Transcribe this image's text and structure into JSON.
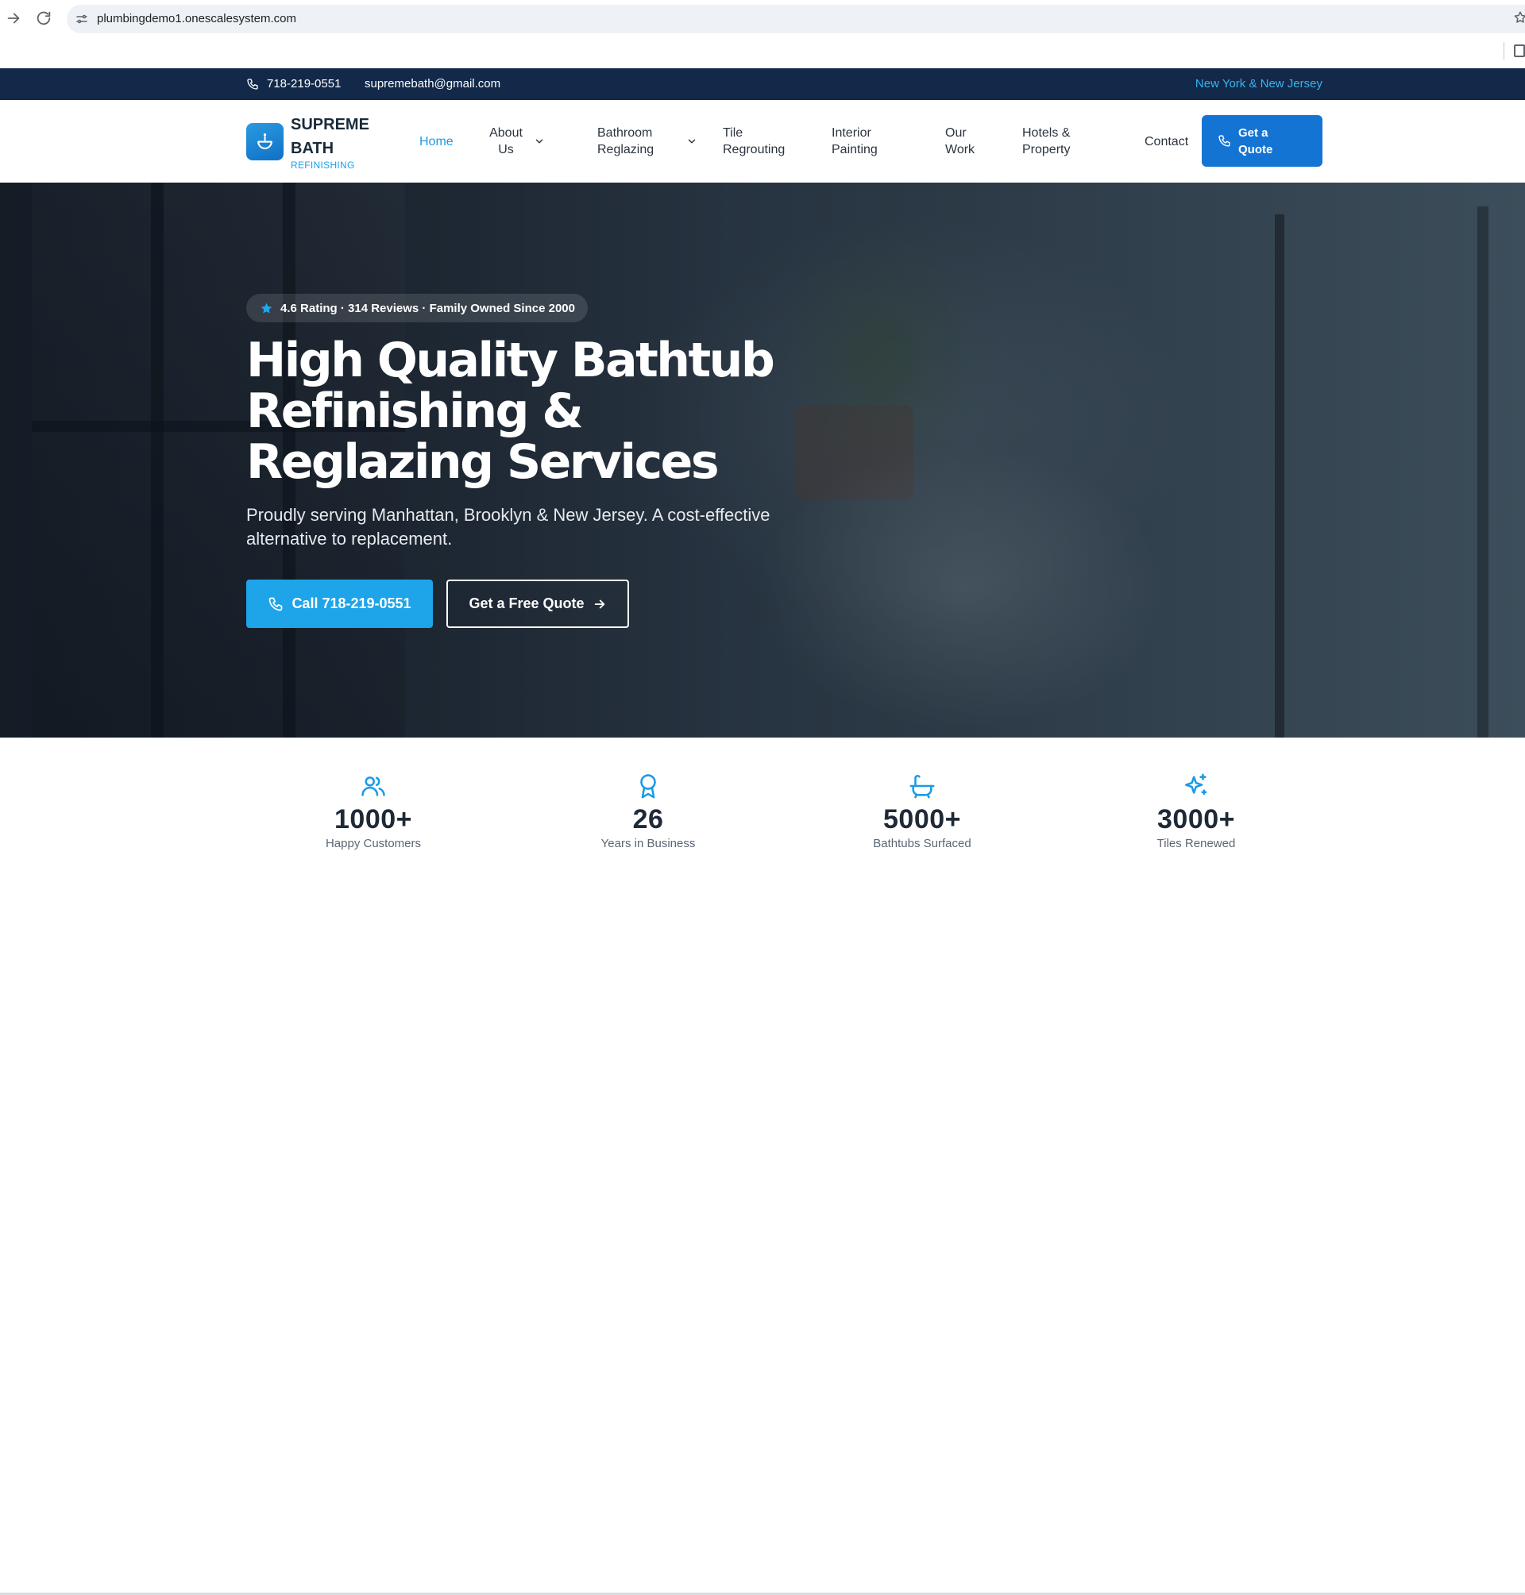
{
  "browser": {
    "url": "plumbingdemo1.onescalesystem.com",
    "icons": [
      "forward-icon",
      "reload-icon",
      "site-info-icon",
      "bookmark-star-icon",
      "side-panel-icon"
    ]
  },
  "topbar": {
    "phone": "718-219-0551",
    "email": "supremebath@gmail.com",
    "region": "New York & New Jersey"
  },
  "brand": {
    "line1": "SUPREME",
    "line2": "BATH",
    "tagline": "REFINISHING"
  },
  "nav": {
    "home": "Home",
    "about_l1": "About",
    "about_l2": "Us",
    "bathroom_l1": "Bathroom",
    "bathroom_l2": "Reglazing",
    "tile_l1": "Tile",
    "tile_l2": "Regrouting",
    "interior_l1": "Interior",
    "interior_l2": "Painting",
    "work_l1": "Our",
    "work_l2": "Work",
    "hotels_l1": "Hotels &",
    "hotels_l2": "Property",
    "contact": "Contact",
    "quote_l1": "Get a",
    "quote_l2": "Quote"
  },
  "hero": {
    "rating": "4.6 Rating · 314 Reviews · Family Owned Since 2000",
    "title_l1": "High Quality Bathtub",
    "title_l2": "Refinishing &",
    "title_l3": "Reglazing Services",
    "subtitle": "Proudly serving Manhattan, Brooklyn & New Jersey. A cost-effective alternative to replacement.",
    "call_button": "Call 718-219-0551",
    "quote_button": "Get a Free Quote"
  },
  "stats": [
    {
      "icon": "users-icon",
      "value": "1000+",
      "label": "Happy Customers"
    },
    {
      "icon": "award-icon",
      "value": "26",
      "label": "Years in Business"
    },
    {
      "icon": "bathtub-icon",
      "value": "5000+",
      "label": "Bathtubs Surfaced"
    },
    {
      "icon": "sparkles-icon",
      "value": "3000+",
      "label": "Tiles Renewed"
    }
  ],
  "colors": {
    "topbar_bg": "#12294a",
    "accent": "#1a9be6",
    "quote_button_bg": "#1474d3",
    "call_button_bg": "#1ea4e8"
  }
}
